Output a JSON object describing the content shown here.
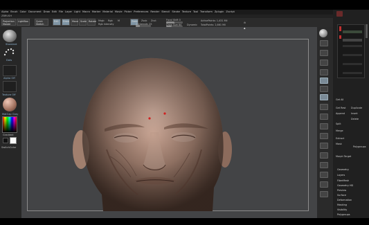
{
  "app": {
    "title": "ZBRUSH"
  },
  "menu": [
    "Alpha",
    "Brush",
    "Color",
    "Document",
    "Draw",
    "Edit",
    "File",
    "Layer",
    "Light",
    "Macro",
    "Marker",
    "Material",
    "Movie",
    "Picker",
    "Preferences",
    "Render",
    "Stencil",
    "Stroke",
    "Texture",
    "Tool",
    "Transform",
    "Zplugin",
    "Zscript"
  ],
  "toolbar": {
    "projection_master": "Projection Master",
    "lightbox": "LightBox",
    "quick_sketch": "Quick Sketch",
    "edit": "Edit",
    "draw": "Draw",
    "move": "Move",
    "scale": "Scale",
    "rotate": "Rotate",
    "mrgb": "Mrgb",
    "rgb": "Rgb",
    "m": "M",
    "zadd": "Zadd",
    "zsub": "Zsub",
    "zcut": "Zcut",
    "rgb_intensity": "Rgb Intensity",
    "z_intensity": "Z Intensity 25",
    "focal_shift": "Focal Shift 0",
    "draw_size": "Draw Size 64",
    "dynamic": "Dynamic",
    "active_points": "ActivePoints: 1,431 Mil",
    "total_points": "TotalPoints: 2,861 Mil"
  },
  "toolbar_values": {
    "rgb_intensity": 0.5,
    "z_intensity": 0.25,
    "focal_shift": 0.5,
    "draw_size": 0.35
  },
  "left_shelf": {
    "brush_label": "Standard",
    "stroke_label": "Dots",
    "alpha_label": "Alpha Off",
    "texture_label": "Texture Off",
    "material_label": "MatCap Gray",
    "gradient_label": "Gradient",
    "switch_color_label": "SwitchColor",
    "alternate_label": "Alternate"
  },
  "tray": {
    "buttons": [
      "Get All",
      "Get Rest",
      "Duplicate",
      "Append",
      "Insert",
      "Delete",
      "Split",
      "Merge"
    ],
    "labels": [
      "Extract",
      "Mask",
      "Polygroups",
      "Morph Target"
    ],
    "subtool_list": [
      "Geometry",
      "Layers",
      "FiberMesh",
      "Geometry HD",
      "Preview",
      "Surface",
      "Deformation",
      "Masking",
      "Visibility",
      "Polygroups"
    ]
  },
  "colors": {
    "canvas": "#434446",
    "skin": "#b08a78",
    "accent": "#b03030",
    "selected": "#8ea3b3"
  }
}
